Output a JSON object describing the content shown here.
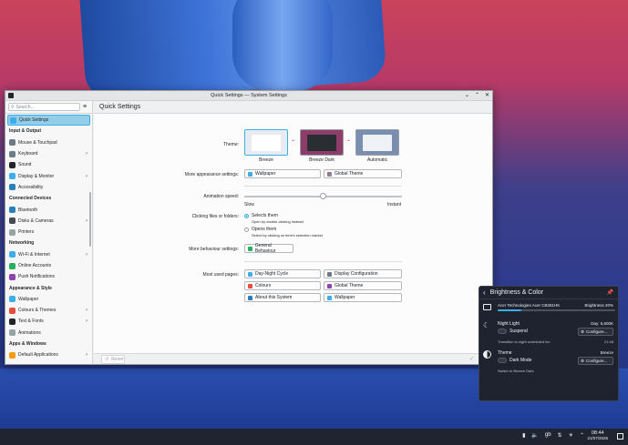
{
  "window": {
    "title": "Quick Settings — System Settings",
    "controls": {
      "minimize": "⌄",
      "maximize": "⌃",
      "close": "✕"
    }
  },
  "sidebar": {
    "search_placeholder": "Search...",
    "items": [
      {
        "type": "item",
        "label": "Quick Settings",
        "icon": "quick-settings-icon",
        "color": "#3daee9",
        "active": true
      },
      {
        "type": "header",
        "label": "Input & Output"
      },
      {
        "type": "item",
        "label": "Mouse & Touchpad",
        "icon": "mouse-icon",
        "color": "#6c7a89"
      },
      {
        "type": "item",
        "label": "Keyboard",
        "icon": "keyboard-icon",
        "color": "#6c7a89",
        "chevron": true
      },
      {
        "type": "item",
        "label": "Sound",
        "icon": "sound-icon",
        "color": "#232629"
      },
      {
        "type": "item",
        "label": "Display & Monitor",
        "icon": "display-icon",
        "color": "#3daee9",
        "chevron": true
      },
      {
        "type": "item",
        "label": "Accessibility",
        "icon": "accessibility-icon",
        "color": "#2980b9"
      },
      {
        "type": "header",
        "label": "Connected Devices"
      },
      {
        "type": "item",
        "label": "Bluetooth",
        "icon": "bluetooth-icon",
        "color": "#2980b9"
      },
      {
        "type": "item",
        "label": "Disks & Cameras",
        "icon": "disks-icon",
        "color": "#444b55",
        "chevron": true
      },
      {
        "type": "item",
        "label": "Printers",
        "icon": "printer-icon",
        "color": "#95a5a6"
      },
      {
        "type": "header",
        "label": "Networking"
      },
      {
        "type": "item",
        "label": "Wi-Fi & Internet",
        "icon": "wifi-icon",
        "color": "#3daee9",
        "chevron": true
      },
      {
        "type": "item",
        "label": "Online Accounts",
        "icon": "online-accounts-icon",
        "color": "#27ae60"
      },
      {
        "type": "item",
        "label": "Push Notifications",
        "icon": "push-notifications-icon",
        "color": "#8e44ad"
      },
      {
        "type": "header",
        "label": "Appearance & Style"
      },
      {
        "type": "item",
        "label": "Wallpaper",
        "icon": "wallpaper-icon",
        "color": "#3daee9"
      },
      {
        "type": "item",
        "label": "Colours & Themes",
        "icon": "colours-icon",
        "color": "#e74c3c",
        "chevron": true
      },
      {
        "type": "item",
        "label": "Text & Fonts",
        "icon": "fonts-icon",
        "color": "#232629",
        "chevron": true
      },
      {
        "type": "item",
        "label": "Animations",
        "icon": "animations-icon",
        "color": "#95a5a6"
      },
      {
        "type": "header",
        "label": "Apps & Windows"
      },
      {
        "type": "item",
        "label": "Default Applications",
        "icon": "default-apps-icon",
        "color": "#f39c12",
        "chevron": true
      }
    ]
  },
  "main": {
    "header": "Quick Settings",
    "theme": {
      "label": "Theme:",
      "options": [
        {
          "name": "Breeze",
          "bg": "#e8ecf0",
          "panel": "#ffffff"
        },
        {
          "name": "Breeze Dark",
          "bg": "#8e3d6a",
          "panel": "#2a2e32"
        },
        {
          "name": "Automatic",
          "bg": "#7a8fb0",
          "panel": "#eef1f5"
        }
      ]
    },
    "appearance": {
      "label": "More appearance settings:",
      "wallpaper": "Wallpaper",
      "global_theme": "Global Theme"
    },
    "animation": {
      "label": "Animation speed:",
      "slow": "Slow",
      "instant": "Instant",
      "value": 0.5
    },
    "clicking": {
      "label": "Clicking files or folders:",
      "opt1": "Selects them",
      "opt1_hint": "Open by double-clicking instead",
      "opt2": "Opens them",
      "opt2_hint": "Select by clicking on item's selection marker"
    },
    "behaviour": {
      "label": "More behaviour settings:",
      "button": "General Behaviour"
    },
    "most_used": {
      "label": "Most used pages:",
      "pages": [
        "Day-Night Cycle",
        "Display Configuration",
        "Colours",
        "Global Theme",
        "About this System",
        "Wallpaper"
      ]
    },
    "footer": {
      "reset": "Reset"
    }
  },
  "panel": {
    "title": "Brightness & Color",
    "monitor": {
      "name": "Acer Technologies Acer CB281HK",
      "brightness_label": "Brightness 20%",
      "brightness": 0.2
    },
    "night_light": {
      "title": "Night Light",
      "status": "Day: 6,500K",
      "toggle": "Suspend",
      "configure": "Configure...",
      "note": "Transition to night scheduled for:",
      "time": "21:48"
    },
    "theme": {
      "title": "Theme",
      "status": "Breeze",
      "toggle": "Dark Mode",
      "configure": "Configure...",
      "note": "Switch to Breeze Dark"
    }
  },
  "taskbar": {
    "kb_layout": "gb",
    "time": "08:44",
    "date": "21/07/2026"
  }
}
